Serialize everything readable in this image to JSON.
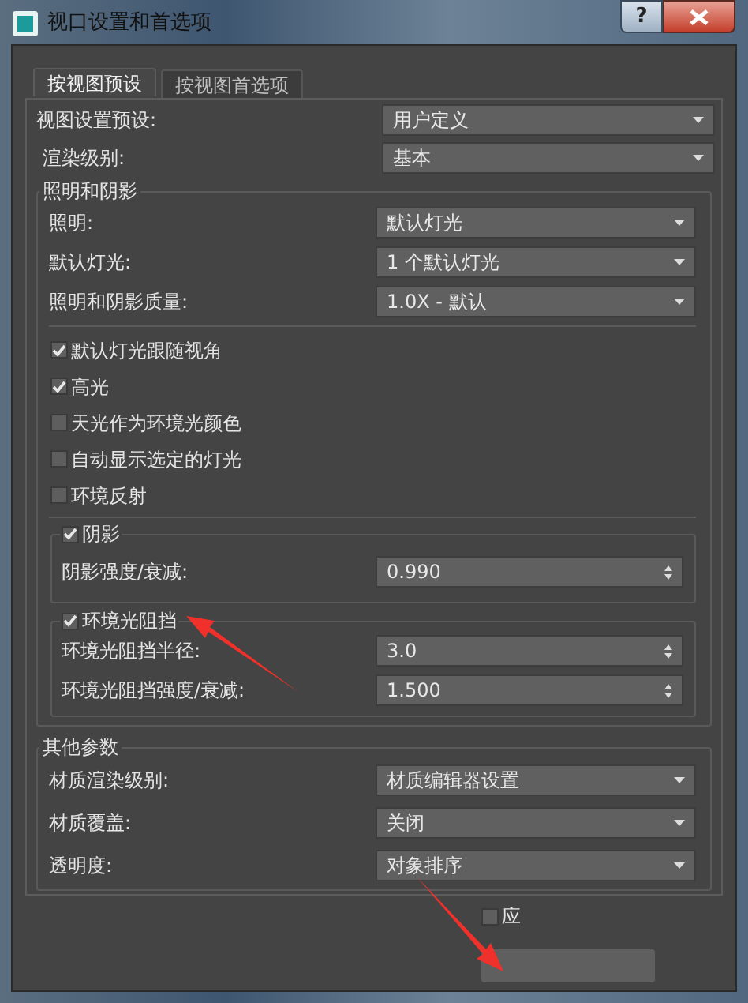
{
  "window": {
    "title": "视口设置和首选项",
    "help_label": "?"
  },
  "tabs": [
    {
      "label": "按视图预设",
      "selected": true
    },
    {
      "label": "按视图首选项",
      "selected": false
    }
  ],
  "preset_rows": [
    {
      "kind": "dropdown",
      "label": "视图设置预设:",
      "value": "用户定义"
    },
    {
      "kind": "dropdown",
      "label": "渲染级别:",
      "value": "基本"
    }
  ],
  "lighting_group": {
    "title": "照明和阴影",
    "rows": [
      {
        "kind": "dropdown",
        "label": "照明:",
        "value": "默认灯光"
      },
      {
        "kind": "dropdown",
        "label": "默认灯光:",
        "value": "1 个默认灯光"
      },
      {
        "kind": "dropdown",
        "label": "照明和阴影质量:",
        "value": "1.0X - 默认"
      }
    ],
    "options": [
      {
        "label": "默认灯光跟随视角",
        "checked": true
      },
      {
        "label": "高光",
        "checked": true
      },
      {
        "label": "天光作为环境光颜色",
        "checked": false
      },
      {
        "label": "自动显示选定的灯光",
        "checked": false
      },
      {
        "label": "环境反射",
        "checked": false
      }
    ],
    "subgroups": [
      {
        "label": "阴影",
        "checked": true,
        "rows": [
          {
            "kind": "spinner",
            "label": "阴影强度/衰减:",
            "value": "0.990"
          }
        ]
      },
      {
        "label": "环境光阻挡",
        "checked": true,
        "rows": [
          {
            "kind": "spinner",
            "label": "环境光阻挡半径:",
            "value": "3.0"
          },
          {
            "kind": "spinner",
            "label": "环境光阻挡强度/衰减:",
            "value": "1.500"
          }
        ]
      }
    ]
  },
  "other_group": {
    "title": "其他参数",
    "rows": [
      {
        "kind": "dropdown",
        "label": "材质渲染级别:",
        "value": "材质编辑器设置"
      },
      {
        "kind": "dropdown",
        "label": "材质覆盖:",
        "value": "关闭"
      },
      {
        "kind": "dropdown",
        "label": "透明度:",
        "value": "对象排序"
      }
    ]
  },
  "footer": {
    "checkbox": {
      "label": "应",
      "checked": false
    }
  }
}
